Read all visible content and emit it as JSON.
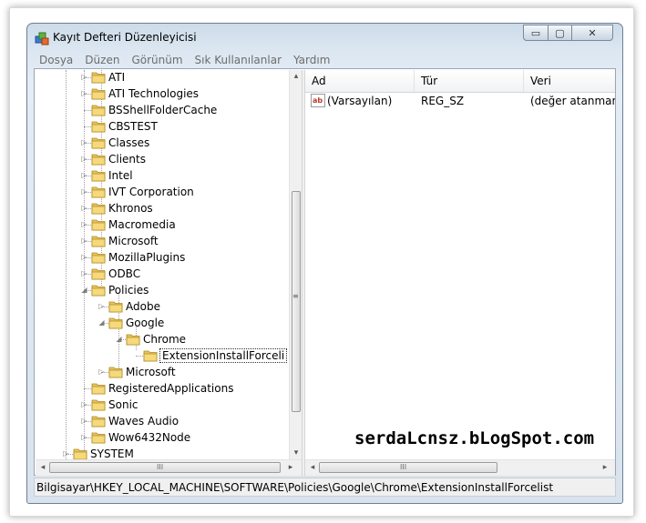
{
  "window": {
    "title": "Kayıt Defteri Düzenleyicisi",
    "min_glyph": "▭",
    "max_glyph": "▢",
    "close_glyph": "✕"
  },
  "menu": [
    "Dosya",
    "Düzen",
    "Görünüm",
    "Sık Kullanılanlar",
    "Yardım"
  ],
  "tree": {
    "nodes": [
      {
        "label": "ATI",
        "expander": "▷"
      },
      {
        "label": "ATI Technologies",
        "expander": "▷"
      },
      {
        "label": "BSShellFolderCache",
        "expander": ""
      },
      {
        "label": "CBSTEST",
        "expander": ""
      },
      {
        "label": "Classes",
        "expander": "▷"
      },
      {
        "label": "Clients",
        "expander": "▷"
      },
      {
        "label": "Intel",
        "expander": "▷"
      },
      {
        "label": "IVT Corporation",
        "expander": "▷"
      },
      {
        "label": "Khronos",
        "expander": "▷"
      },
      {
        "label": "Macromedia",
        "expander": "▷"
      },
      {
        "label": "Microsoft",
        "expander": "▷"
      },
      {
        "label": "MozillaPlugins",
        "expander": "▷"
      },
      {
        "label": "ODBC",
        "expander": "▷"
      },
      {
        "label": "Policies",
        "expander": "◢"
      },
      {
        "label": "Adobe",
        "expander": "▷"
      },
      {
        "label": "Google",
        "expander": "◢"
      },
      {
        "label": "Chrome",
        "expander": "◢"
      },
      {
        "label": "ExtensionInstallForceli",
        "expander": ""
      },
      {
        "label": "Microsoft",
        "expander": "▷"
      },
      {
        "label": "RegisteredApplications",
        "expander": ""
      },
      {
        "label": "Sonic",
        "expander": "▷"
      },
      {
        "label": "Waves Audio",
        "expander": "▷"
      },
      {
        "label": "Wow6432Node",
        "expander": "▷"
      },
      {
        "label": "SYSTEM",
        "expander": "▷"
      }
    ],
    "scroll_left": "◂",
    "scroll_right": "▸",
    "scroll_up": "▴",
    "scroll_down": "▾",
    "grip": "≡",
    "hgrip": "III"
  },
  "list": {
    "columns": [
      "Ad",
      "Tür",
      "Veri"
    ],
    "rows": [
      {
        "name": "(Varsayılan)",
        "type": "REG_SZ",
        "data": "(değer atanmamış)",
        "icon": "string-value-icon"
      }
    ],
    "scroll_left": "◂",
    "scroll_right": "▸",
    "hgrip": "III"
  },
  "watermark": "serdaLcnsz.bLogSpot.com",
  "status": {
    "path": "Bilgisayar\\HKEY_LOCAL_MACHINE\\SOFTWARE\\Policies\\Google\\Chrome\\ExtensionInstallForcelist"
  },
  "colors": {
    "folder": "#e8c45a",
    "titlebar": "#cddbe9",
    "menu_text": "#6d6d6d"
  }
}
